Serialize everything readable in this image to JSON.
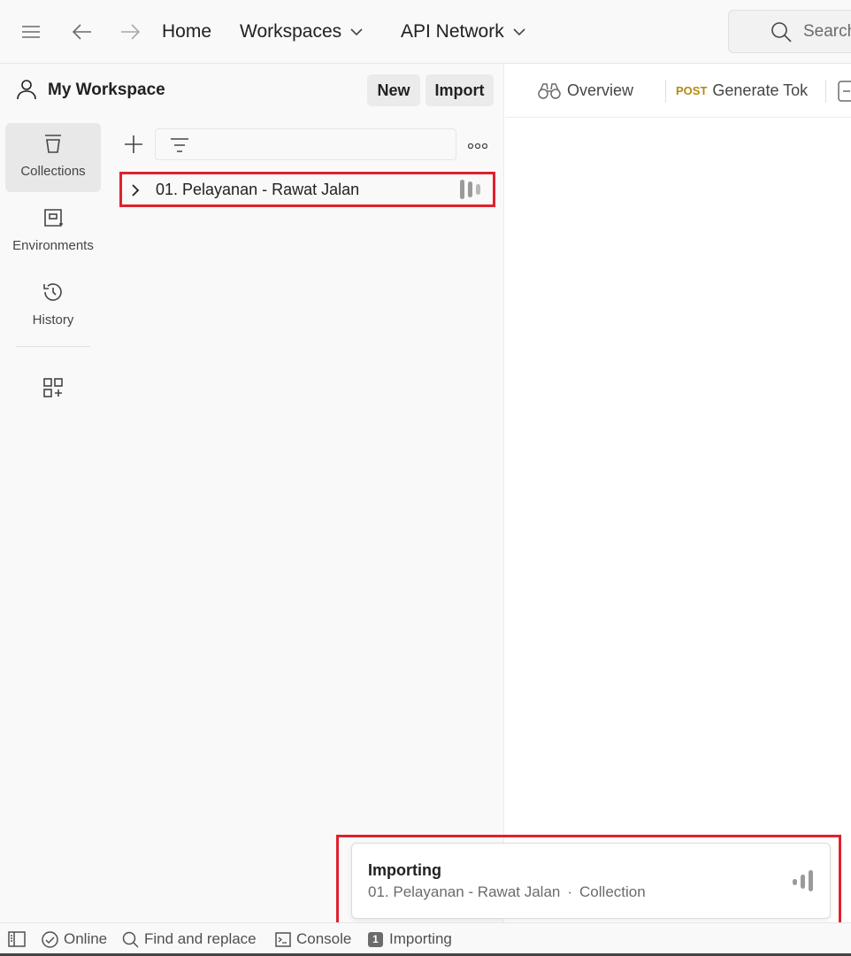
{
  "topbar": {
    "nav_home": "Home",
    "nav_workspaces": "Workspaces",
    "nav_api_network": "API Network",
    "search_placeholder": "Search"
  },
  "workspace": {
    "name": "My Workspace",
    "new_label": "New",
    "import_label": "Import"
  },
  "sidebar": {
    "items": [
      {
        "label": "Collections",
        "icon": "collections-icon",
        "active": true
      },
      {
        "label": "Environments",
        "icon": "environments-icon",
        "active": false
      },
      {
        "label": "History",
        "icon": "history-icon",
        "active": false
      }
    ]
  },
  "collections": {
    "items": [
      {
        "name": "01. Pelayanan - Rawat Jalan",
        "status": "loading"
      }
    ]
  },
  "tabs": {
    "overview_label": "Overview",
    "request_method": "POST",
    "request_name": "Generate Tok"
  },
  "toast": {
    "title": "Importing",
    "item_name": "01. Pelayanan - Rawat Jalan",
    "separator": "·",
    "item_type": "Collection"
  },
  "statusbar": {
    "online": "Online",
    "find_replace": "Find and replace",
    "console": "Console",
    "importing_count": "1",
    "importing_label": "Importing"
  },
  "colors": {
    "highlight": "#e0212e",
    "post_method": "#b58a10",
    "panel_bg": "#f9f9f9"
  }
}
